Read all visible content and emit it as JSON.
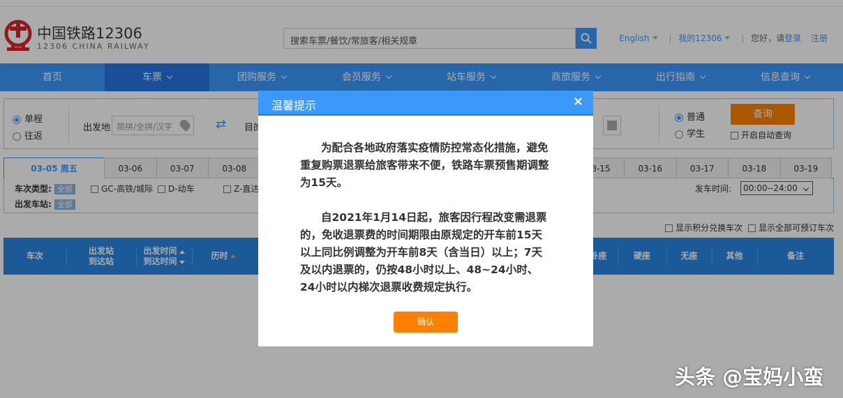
{
  "header": {
    "logo_cn": "中国铁路12306",
    "logo_en": "12306 CHINA RAILWAY",
    "search_placeholder": "搜索车票/餐饮/常旅客/相关规章",
    "lang": "English",
    "my12306": "我的12306",
    "greeting": "您好，请",
    "login": "登录",
    "register": "注册"
  },
  "nav": [
    {
      "label": "首页",
      "dropdown": false
    },
    {
      "label": "车票",
      "dropdown": true,
      "active": true
    },
    {
      "label": "团购服务",
      "dropdown": true
    },
    {
      "label": "会员服务",
      "dropdown": true
    },
    {
      "label": "站车服务",
      "dropdown": true
    },
    {
      "label": "商旅服务",
      "dropdown": true
    },
    {
      "label": "出行指南",
      "dropdown": true
    },
    {
      "label": "信息查询",
      "dropdown": true
    }
  ],
  "query": {
    "single": "单程",
    "round": "往返",
    "from_label": "出发地",
    "from_placeholder": "简拼/全拼/汉字",
    "to_label": "目的",
    "normal": "普通",
    "student": "学生",
    "search_btn": "查询",
    "auto_query": "开启自动查询"
  },
  "dates": [
    "03-05 周五",
    "03-06",
    "03-07",
    "03-08",
    "03-15",
    "03-16",
    "03-17",
    "03-18",
    "03-19"
  ],
  "filter": {
    "type_label": "车次类型:",
    "station_label": "出发车站:",
    "all": "全部",
    "gc": "GC-高铁/城际",
    "d": "D-动车",
    "z": "Z-直达",
    "time_label": "发车时间:",
    "time_value": "00:00--24:00",
    "points": "显示积分兑换车次",
    "all_bookable": "显示全部可预订车次"
  },
  "table": {
    "train": "车次",
    "stations_1": "出发站",
    "stations_2": "到达站",
    "times_1": "出发时间",
    "times_2": "到达时间",
    "duration": "历时",
    "seat_partial": "卧座",
    "hard_seat": "硬座",
    "no_seat": "无座",
    "other": "其他",
    "remark": "备注"
  },
  "modal": {
    "title": "温馨提示",
    "close": "×",
    "para1": "为配合各地政府落实疫情防控常态化措施，避免重复购票退票给旅客带来不便，铁路车票预售期调整为15天。",
    "para2": "自2021年1月14日起，旅客因行程改变需退票的，免收退票费的时间期限由原规定的开车前15天以上同比例调整为开车前8天（含当日）以上；7天及以内退票的，仍按48小时以上、48~24小时、24小时以内梯次退票收费规定执行。",
    "confirm": "确认"
  },
  "watermark": "头条 @宝妈小蛮"
}
